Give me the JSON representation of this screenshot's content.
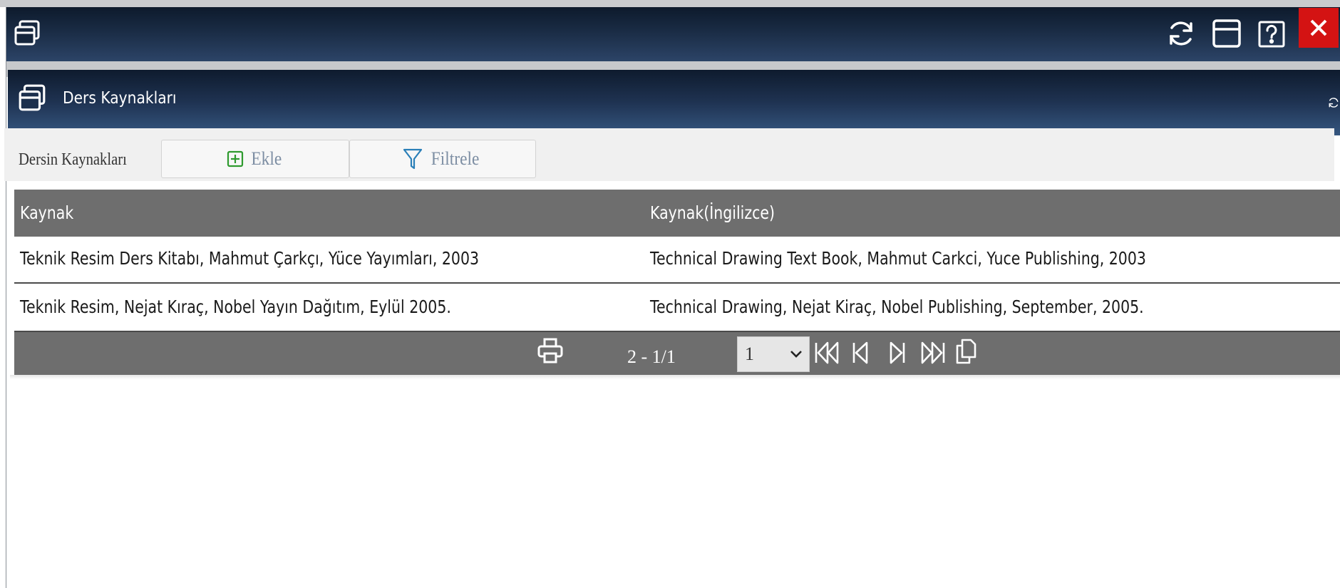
{
  "window": {
    "inner_title": "Ders Kaynakları"
  },
  "toolbar": {
    "label": "Dersin Kaynakları",
    "add_label": "Ekle",
    "filter_label": "Filtrele"
  },
  "table": {
    "columns": [
      "Kaynak",
      "Kaynak(İngilizce)"
    ],
    "rows": [
      [
        "Teknik Resim Ders Kitabı, Mahmut Çarkçı, Yüce Yayımları, 2003",
        "Technical Drawing Text Book, Mahmut Carkci, Yuce Publishing, 2003"
      ],
      [
        "Teknik Resim, Nejat Kıraç, Nobel Yayın Dağıtım, Eylül 2005.",
        "Technical Drawing, Nejat Kiraç, Nobel Publishing, September, 2005."
      ]
    ]
  },
  "pager": {
    "info": "2 - 1/1",
    "selected_page": "1"
  },
  "colors": {
    "titlebar": "#1a2c45",
    "close_button": "#d41313",
    "table_header": "#6e6e6e",
    "add_icon": "#2e9a2e",
    "filter_icon": "#2a7fb8"
  },
  "icons": {
    "window": "window-stack-icon",
    "refresh": "refresh-icon",
    "maximize": "maximize-icon",
    "help": "help-icon",
    "close": "close-icon",
    "add": "plus-square-icon",
    "filter": "filter-icon",
    "print": "printer-icon",
    "first": "first-page-icon",
    "prev": "prev-page-icon",
    "next": "next-page-icon",
    "last": "last-page-icon",
    "copy": "copy-icon"
  }
}
